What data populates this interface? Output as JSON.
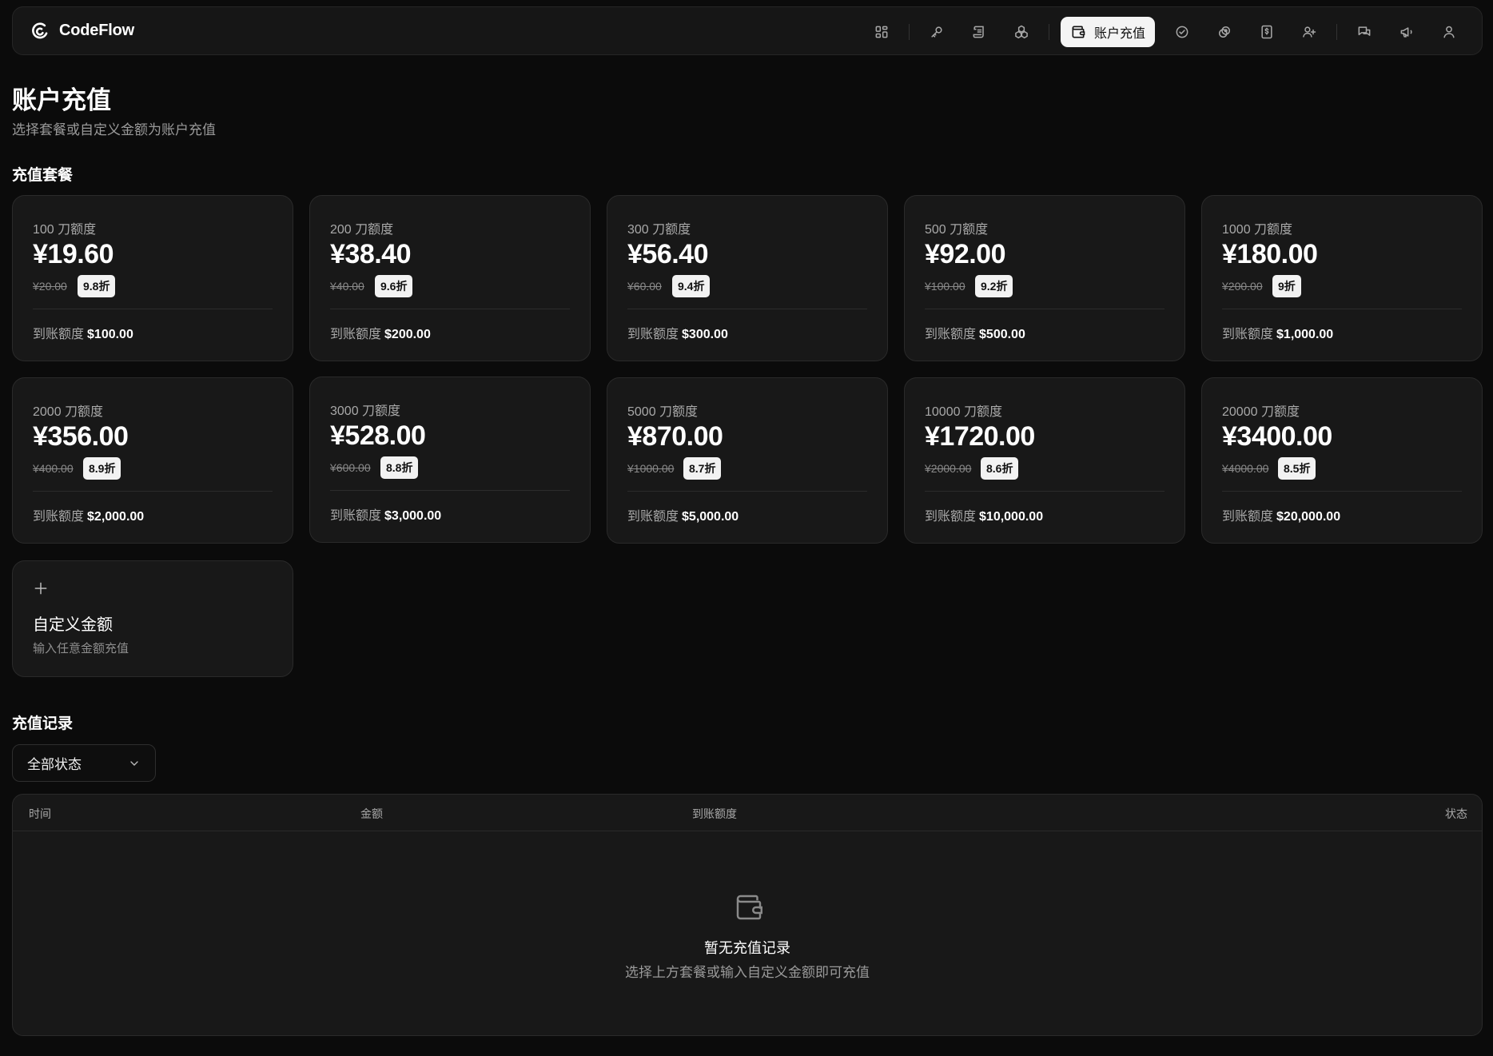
{
  "brand": {
    "name": "CodeFlow"
  },
  "nav": {
    "icons": [
      "dashboard-icon",
      "key-icon",
      "logs-icon",
      "models-icon",
      "wallet-icon",
      "check-circle-icon",
      "link-icon",
      "billing-icon",
      "add-user-icon",
      "chat-icon",
      "megaphone-icon",
      "profile-icon"
    ],
    "active_label": "账户充值"
  },
  "page": {
    "title": "账户充值",
    "subtitle": "选择套餐或自定义金额为账户充值"
  },
  "packages": {
    "section_title": "充值套餐",
    "credit_label": "到账额度",
    "items": [
      {
        "name": "100 刀额度",
        "price": "¥19.60",
        "original": "¥20.00",
        "discount": "9.8折",
        "credit": "$100.00"
      },
      {
        "name": "200 刀额度",
        "price": "¥38.40",
        "original": "¥40.00",
        "discount": "9.6折",
        "credit": "$200.00"
      },
      {
        "name": "300 刀额度",
        "price": "¥56.40",
        "original": "¥60.00",
        "discount": "9.4折",
        "credit": "$300.00"
      },
      {
        "name": "500 刀额度",
        "price": "¥92.00",
        "original": "¥100.00",
        "discount": "9.2折",
        "credit": "$500.00"
      },
      {
        "name": "1000 刀额度",
        "price": "¥180.00",
        "original": "¥200.00",
        "discount": "9折",
        "credit": "$1,000.00"
      },
      {
        "name": "2000 刀额度",
        "price": "¥356.00",
        "original": "¥400.00",
        "discount": "8.9折",
        "credit": "$2,000.00"
      },
      {
        "name": "3000 刀额度",
        "price": "¥528.00",
        "original": "¥600.00",
        "discount": "8.8折",
        "credit": "$3,000.00"
      },
      {
        "name": "5000 刀额度",
        "price": "¥870.00",
        "original": "¥1000.00",
        "discount": "8.7折",
        "credit": "$5,000.00"
      },
      {
        "name": "10000 刀额度",
        "price": "¥1720.00",
        "original": "¥2000.00",
        "discount": "8.6折",
        "credit": "$10,000.00"
      },
      {
        "name": "20000 刀额度",
        "price": "¥3400.00",
        "original": "¥4000.00",
        "discount": "8.5折",
        "credit": "$20,000.00"
      }
    ],
    "custom": {
      "title": "自定义金额",
      "subtitle": "输入任意金额充值"
    }
  },
  "records": {
    "section_title": "充值记录",
    "filter": {
      "selected": "全部状态"
    },
    "columns": [
      "时间",
      "金额",
      "到账额度",
      "状态"
    ],
    "rows": [],
    "empty": {
      "title": "暂无充值记录",
      "subtitle": "选择上方套餐或输入自定义金额即可充值"
    }
  }
}
